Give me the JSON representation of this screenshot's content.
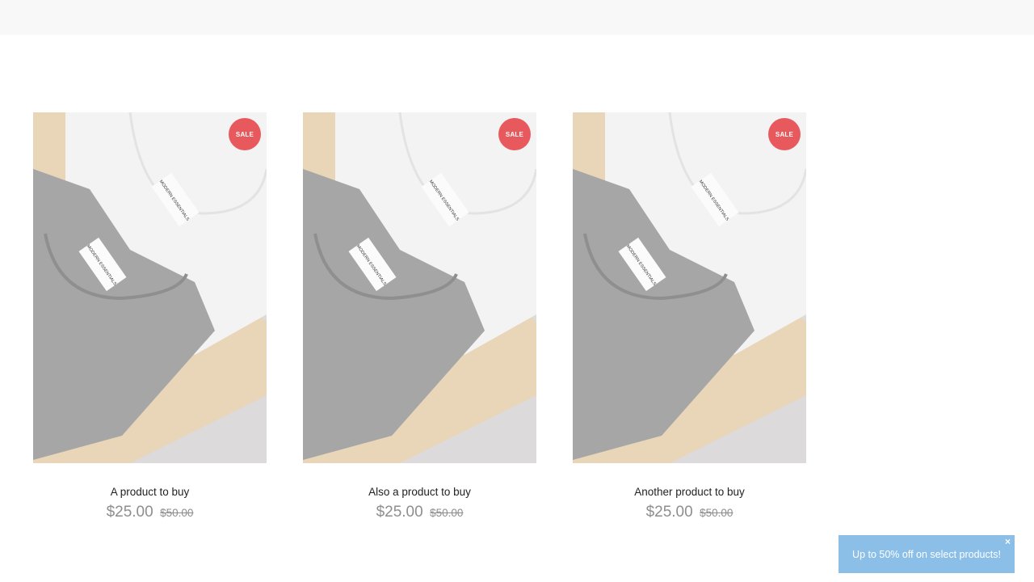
{
  "products": [
    {
      "title": "A product to buy",
      "badge": "SALE",
      "price": "$25.00",
      "compare_price": "$50.00",
      "tag_text": "MODERN ESSENTIALS"
    },
    {
      "title": "Also a product to buy",
      "badge": "SALE",
      "price": "$25.00",
      "compare_price": "$50.00",
      "tag_text": "MODERN ESSENTIALS"
    },
    {
      "title": "Another product to buy",
      "badge": "SALE",
      "price": "$25.00",
      "compare_price": "$50.00",
      "tag_text": "MODERN ESSENTIALS"
    }
  ],
  "promo": {
    "text": "Up to 50% off on select products!",
    "close_label": "×"
  },
  "colors": {
    "sale_badge": "#e8595d",
    "promo_bg": "#8bbfe8",
    "price_text": "#8e8e8e",
    "header_bg": "#f8f8f8"
  },
  "icons": {
    "promo_close": "close-icon"
  }
}
